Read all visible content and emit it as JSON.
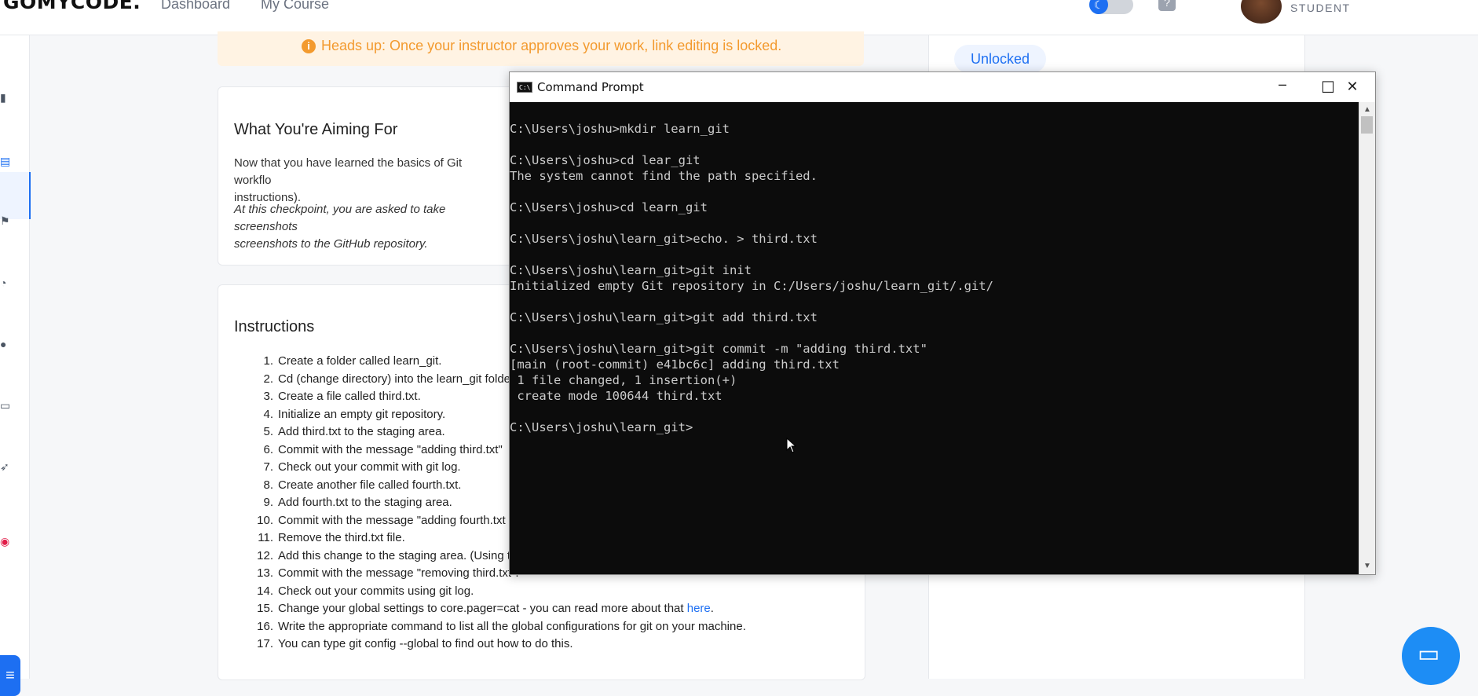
{
  "header": {
    "logo": "GOMYCODE.",
    "nav": [
      "Dashboard",
      "My Course"
    ],
    "role": "STUDENT"
  },
  "alert": {
    "text": "Heads up: Once your instructor approves your work, link editing is locked."
  },
  "status": {
    "label": "Unlocked"
  },
  "aiming": {
    "title": "What You're Aiming For",
    "p1": "Now that you have learned the basics of Git workflo",
    "p1b": "instructions).",
    "p2a": "At this checkpoint, you are asked to take screenshots",
    "p2b": "screenshots to the GitHub repository."
  },
  "instructions": {
    "title": "Instructions",
    "steps": [
      "Create a folder called learn_git.",
      "Cd (change directory) into the learn_git folde",
      "Create a file called third.txt.",
      "Initialize an empty git repository.",
      "Add third.txt to the staging area.",
      "Commit with the message \"adding third.txt\"",
      "Check out your commit with git log.",
      "Create another file called fourth.txt.",
      "Add fourth.txt to the staging area.",
      "Commit with the message \"adding fourth.txt",
      "Remove the third.txt file.",
      "Add this change to the staging area. (Using t",
      "Commit with the message \"removing third.txt\".",
      "Check out your commits using git log.",
      "Change your global settings to core.pager=cat - you can read more about that ",
      "Write the appropriate command to list all the global configurations for git on your machine.",
      "You can type git config --global to find out how to do this."
    ],
    "link_text": "here"
  },
  "cmd": {
    "title": "Command Prompt",
    "lines": [
      "",
      "C:\\Users\\joshu>mkdir learn_git",
      "",
      "C:\\Users\\joshu>cd lear_git",
      "The system cannot find the path specified.",
      "",
      "C:\\Users\\joshu>cd learn_git",
      "",
      "C:\\Users\\joshu\\learn_git>echo. > third.txt",
      "",
      "C:\\Users\\joshu\\learn_git>git init",
      "Initialized empty Git repository in C:/Users/joshu/learn_git/.git/",
      "",
      "C:\\Users\\joshu\\learn_git>git add third.txt",
      "",
      "C:\\Users\\joshu\\learn_git>git commit -m \"adding third.txt\"",
      "[main (root-commit) e41bc6c] adding third.txt",
      " 1 file changed, 1 insertion(+)",
      " create mode 100644 third.txt",
      "",
      "C:\\Users\\joshu\\learn_git>"
    ],
    "buttons": {
      "minimize": "─",
      "maximize": "☐",
      "close": "✕"
    },
    "icon_text": "C:\\"
  },
  "icons": [
    "chart-icon",
    "document-icon",
    "flag-icon",
    "headset-icon",
    "users-icon",
    "laptop-icon",
    "rocket-icon",
    "badge-icon",
    "menu-icon",
    "moon-icon",
    "help-icon",
    "chat-icon",
    "info-icon"
  ],
  "colors": {
    "accent": "#1d6ff2",
    "alert_bg": "#fff3e3",
    "alert_text": "#f39a2e",
    "terminal_bg": "#0c0c0c",
    "terminal_text": "#cccccc"
  }
}
